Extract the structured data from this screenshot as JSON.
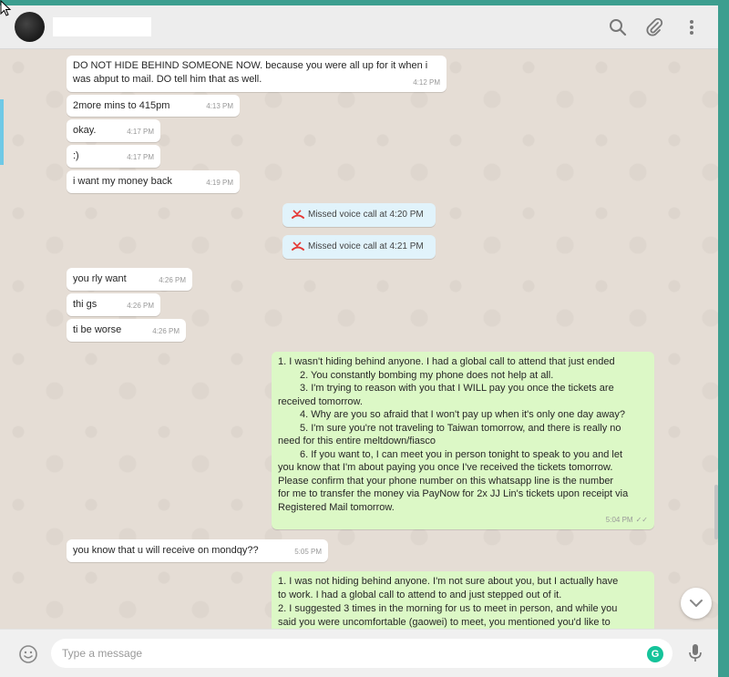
{
  "header": {
    "contact_name": ""
  },
  "messages": {
    "m1": {
      "text": "DO NOT HIDE BEHIND SOMEONE NOW. because you were all up for it when i\nwas abput to mail. DO tell him that as well.",
      "time": "4:12 PM"
    },
    "m2": {
      "text": "2more mins to 415pm",
      "time": "4:13 PM"
    },
    "m3": {
      "text": "okay.",
      "time": "4:17 PM"
    },
    "m4": {
      "text": ":)",
      "time": "4:17 PM"
    },
    "m5": {
      "text": "i want my money back",
      "time": "4:19 PM"
    },
    "call1": {
      "text": "Missed voice call at 4:20 PM"
    },
    "call2": {
      "text": "Missed voice call at 4:21 PM"
    },
    "m6": {
      "text": "you rly want",
      "time": "4:26 PM"
    },
    "m7": {
      "text": "thi gs",
      "time": "4:26 PM"
    },
    "m8": {
      "text": "ti be worse",
      "time": "4:26 PM"
    },
    "m9": {
      "line1": "1. I wasn't hiding behind anyone. I had a global call to attend that just ended",
      "line2": "2. You constantly bombing my phone does not help at all.",
      "line3a": "3. I'm trying to reason with you that I WILL pay you once the tickets are",
      "line3b": "received tomorrow.",
      "line4": "4. Why are you so afraid that I won't pay up when it's only one day away?",
      "line5a": "5. I'm sure you're not traveling to Taiwan tomorrow, and there is really no",
      "line5b": "need for this entire meltdown/fiasco",
      "line6a": "6. If you want to, I can meet you in person tonight to speak to you and let",
      "line6b": "you know that I'm about paying you once I've received the tickets tomorrow.",
      "line6c": "Please confirm that your phone number on this whatsapp line is the number",
      "line6d": "for me to transfer the money via PayNow for 2x JJ Lin's tickets upon receipt via",
      "line6e": "Registered Mail tomorrow.",
      "time": "5:04 PM"
    },
    "m10": {
      "text": "you know that u will receive on mondqy??",
      "time": "5:05 PM"
    },
    "m11": {
      "line1": "1. I was not hiding behind anyone. I'm not sure about you, but I actually have",
      "line2": "to work. I had a global call to attend to and just stepped out of it.",
      "line3": "2. I suggested 3 times in the morning for us to meet in person, and while you",
      "line4": "said you were uncomfortable (gaowei) to meet, you mentioned you'd like to"
    }
  },
  "footer": {
    "placeholder": "Type a message",
    "grammarly": "G"
  },
  "colors": {
    "incoming": "#ffffff",
    "outgoing": "#dcf8c6",
    "system": "#e1f3fb",
    "missed_call": "#e53935",
    "header_bg": "#ededed",
    "chat_bg": "#e5ddd5",
    "teal_border": "#3c9e8f"
  }
}
